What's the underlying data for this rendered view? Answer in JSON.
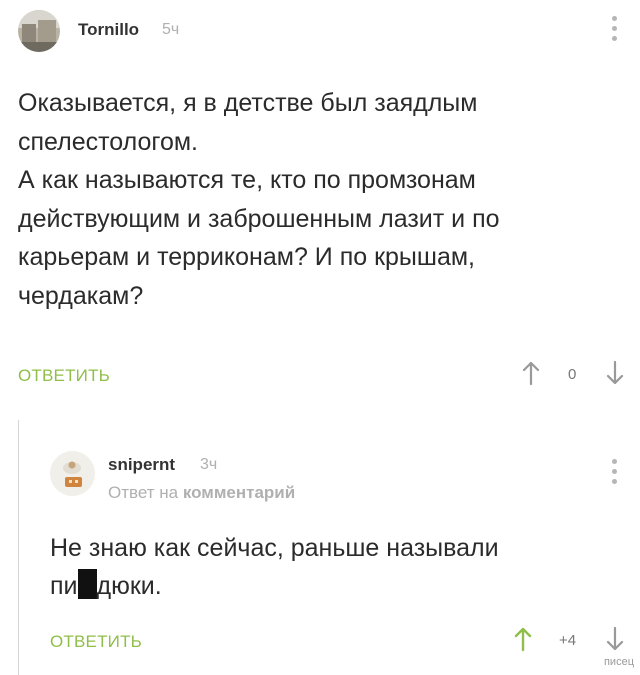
{
  "comment1": {
    "username": "Tornillo",
    "time": "5ч",
    "lines": [
      "Оказывается, я в детстве был заядлым",
      "спелестологом.",
      "А как называются те, кто по промзонам",
      "действующим и заброшенным лазит и по",
      "карьерам и терриконам? И по крышам,",
      "чердакам?"
    ],
    "reply_label": "ОТВЕТИТЬ",
    "rating": "0"
  },
  "comment2": {
    "username": "snipernt",
    "time": "3ч",
    "reply_to_prefix": "Ответ на",
    "reply_to_link": "комментарий",
    "line1": "Не знаю как сейчас, раньше называли",
    "line2_start": "пи",
    "line2_end": "дюки.",
    "reply_label": "ОТВЕТИТЬ",
    "rating": "+4"
  },
  "colors": {
    "accent_green": "#8fbf4a",
    "muted_gray": "#b0b0b0",
    "text": "#2b2b2b"
  },
  "icons": [
    "more-vertical-icon",
    "arrow-up-icon",
    "arrow-down-icon"
  ],
  "watermark": "писец"
}
